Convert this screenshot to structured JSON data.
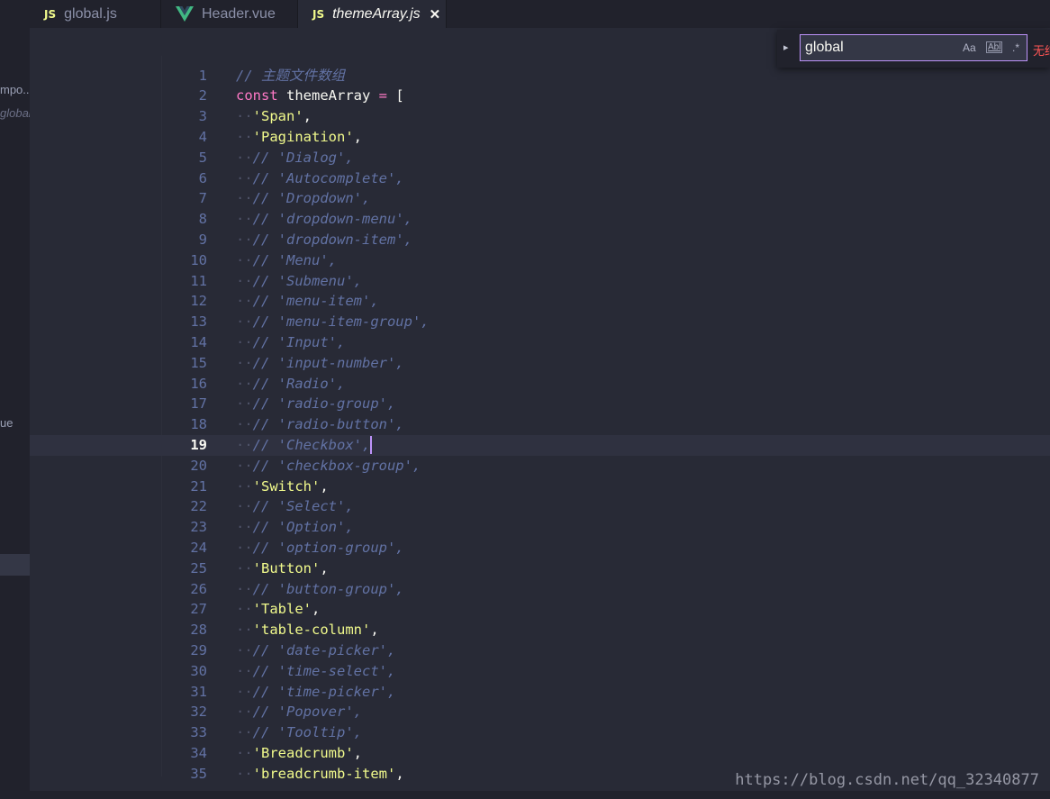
{
  "tabs": [
    {
      "icon": "JS",
      "label": "global.js",
      "active": false
    },
    {
      "icon": "V",
      "label": "Header.vue",
      "active": false
    },
    {
      "icon": "JS",
      "label": "themeArray.js",
      "active": true,
      "close": "✕"
    }
  ],
  "sidebar": {
    "items": [
      {
        "label": "mpo..."
      },
      {
        "label": "global"
      },
      {
        "label": "ue"
      }
    ]
  },
  "find_widget": {
    "query": "global",
    "match_case": "Aa",
    "whole_word": "Abl",
    "regex": ".*",
    "toggle": "▸",
    "result_text": "无结果"
  },
  "editor": {
    "current_line": 19,
    "lines": [
      {
        "n": "1",
        "t": [
          [
            "cm",
            "// 主题文件数组"
          ]
        ]
      },
      {
        "n": "2",
        "t": [
          [
            "kw",
            "const"
          ],
          [
            "id",
            " themeArray "
          ],
          [
            "op",
            "="
          ],
          [
            "pn",
            " ["
          ]
        ]
      },
      {
        "n": "3",
        "d": "··",
        "t": [
          [
            "str",
            "'Span'"
          ],
          [
            "pn",
            ","
          ]
        ]
      },
      {
        "n": "4",
        "d": "··",
        "t": [
          [
            "str",
            "'Pagination'"
          ],
          [
            "pn",
            ","
          ]
        ]
      },
      {
        "n": "5",
        "d": "··",
        "t": [
          [
            "cm",
            "// 'Dialog',"
          ]
        ]
      },
      {
        "n": "6",
        "d": "··",
        "t": [
          [
            "cm",
            "// 'Autocomplete',"
          ]
        ]
      },
      {
        "n": "7",
        "d": "··",
        "t": [
          [
            "cm",
            "// 'Dropdown',"
          ]
        ]
      },
      {
        "n": "8",
        "d": "··",
        "t": [
          [
            "cm",
            "// 'dropdown-menu',"
          ]
        ]
      },
      {
        "n": "9",
        "d": "··",
        "t": [
          [
            "cm",
            "// 'dropdown-item',"
          ]
        ]
      },
      {
        "n": "10",
        "d": "··",
        "t": [
          [
            "cm",
            "// 'Menu',"
          ]
        ]
      },
      {
        "n": "11",
        "d": "··",
        "t": [
          [
            "cm",
            "// 'Submenu',"
          ]
        ]
      },
      {
        "n": "12",
        "d": "··",
        "t": [
          [
            "cm",
            "// 'menu-item',"
          ]
        ]
      },
      {
        "n": "13",
        "d": "··",
        "t": [
          [
            "cm",
            "// 'menu-item-group',"
          ]
        ]
      },
      {
        "n": "14",
        "d": "··",
        "t": [
          [
            "cm",
            "// 'Input',"
          ]
        ]
      },
      {
        "n": "15",
        "d": "··",
        "t": [
          [
            "cm",
            "// 'input-number',"
          ]
        ]
      },
      {
        "n": "16",
        "d": "··",
        "t": [
          [
            "cm",
            "// 'Radio',"
          ]
        ]
      },
      {
        "n": "17",
        "d": "··",
        "t": [
          [
            "cm",
            "// 'radio-group',"
          ]
        ]
      },
      {
        "n": "18",
        "d": "··",
        "t": [
          [
            "cm",
            "// 'radio-button',"
          ]
        ]
      },
      {
        "n": "19",
        "d": "··",
        "t": [
          [
            "cm",
            "// 'Checkbox',"
          ]
        ]
      },
      {
        "n": "20",
        "d": "··",
        "t": [
          [
            "cm",
            "// 'checkbox-group',"
          ]
        ]
      },
      {
        "n": "21",
        "d": "··",
        "t": [
          [
            "str",
            "'Switch'"
          ],
          [
            "pn",
            ","
          ]
        ]
      },
      {
        "n": "22",
        "d": "··",
        "t": [
          [
            "cm",
            "// 'Select',"
          ]
        ]
      },
      {
        "n": "23",
        "d": "··",
        "t": [
          [
            "cm",
            "// 'Option',"
          ]
        ]
      },
      {
        "n": "24",
        "d": "··",
        "t": [
          [
            "cm",
            "// 'option-group',"
          ]
        ]
      },
      {
        "n": "25",
        "d": "··",
        "t": [
          [
            "str",
            "'Button'"
          ],
          [
            "pn",
            ","
          ]
        ]
      },
      {
        "n": "26",
        "d": "··",
        "t": [
          [
            "cm",
            "// 'button-group',"
          ]
        ]
      },
      {
        "n": "27",
        "d": "··",
        "t": [
          [
            "str",
            "'Table'"
          ],
          [
            "pn",
            ","
          ]
        ]
      },
      {
        "n": "28",
        "d": "··",
        "t": [
          [
            "str",
            "'table-column'"
          ],
          [
            "pn",
            ","
          ]
        ]
      },
      {
        "n": "29",
        "d": "··",
        "t": [
          [
            "cm",
            "// 'date-picker',"
          ]
        ]
      },
      {
        "n": "30",
        "d": "··",
        "t": [
          [
            "cm",
            "// 'time-select',"
          ]
        ]
      },
      {
        "n": "31",
        "d": "··",
        "t": [
          [
            "cm",
            "// 'time-picker',"
          ]
        ]
      },
      {
        "n": "32",
        "d": "··",
        "t": [
          [
            "cm",
            "// 'Popover',"
          ]
        ]
      },
      {
        "n": "33",
        "d": "··",
        "t": [
          [
            "cm",
            "// 'Tooltip',"
          ]
        ]
      },
      {
        "n": "34",
        "d": "··",
        "t": [
          [
            "str",
            "'Breadcrumb'"
          ],
          [
            "pn",
            ","
          ]
        ]
      },
      {
        "n": "35",
        "d": "··",
        "t": [
          [
            "str",
            "'breadcrumb-item'"
          ],
          [
            "pn",
            ","
          ]
        ]
      }
    ]
  },
  "watermark": "https://blog.csdn.net/qq_32340877",
  "colors": {
    "background": "#282a36",
    "comment": "#6272a4",
    "string": "#f1fa8c",
    "keyword": "#ff79c6",
    "accent": "#bd93f9"
  }
}
